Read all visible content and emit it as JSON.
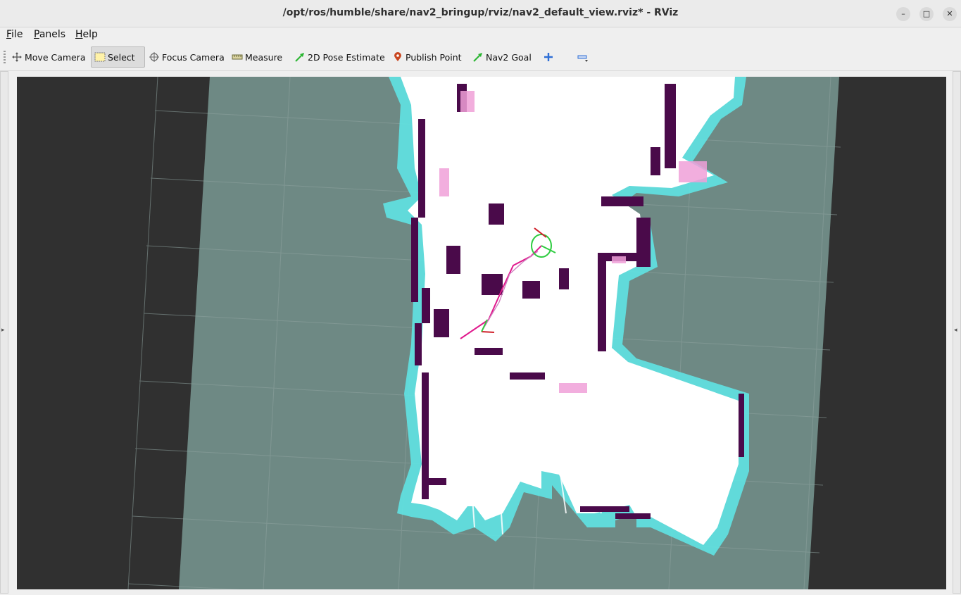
{
  "window": {
    "title": "/opt/ros/humble/share/nav2_bringup/rviz/nav2_default_view.rviz* - RViz",
    "controls": {
      "minimize": "–",
      "maximize": "□",
      "close": "✕"
    }
  },
  "menubar": {
    "items": [
      {
        "label": "File",
        "mnemonic": "F",
        "rest": "ile"
      },
      {
        "label": "Panels",
        "mnemonic": "P",
        "rest": "anels"
      },
      {
        "label": "Help",
        "mnemonic": "H",
        "rest": "elp"
      }
    ]
  },
  "toolbar": {
    "move_camera": "Move Camera",
    "select": "Select",
    "focus_camera": "Focus Camera",
    "measure": "Measure",
    "pose_estimate": "2D Pose Estimate",
    "publish_point": "Publish Point",
    "nav2_goal": "Nav2 Goal",
    "add_tool_icon": "plus-icon",
    "remove_tool_icon": "minus-icon",
    "active_tool": "Select"
  },
  "colors": {
    "background": "#303030",
    "unknown_space": "#6e8984",
    "free_space": "#ffffff",
    "obstacle": "#4a0a4a",
    "inflation_cyan": "#5fe3e3",
    "inflation_pink": "#f4a3c4",
    "path_magenta": "#e0188c",
    "goal_green": "#2ecc40",
    "accent_blue": "#2f6fd6"
  }
}
